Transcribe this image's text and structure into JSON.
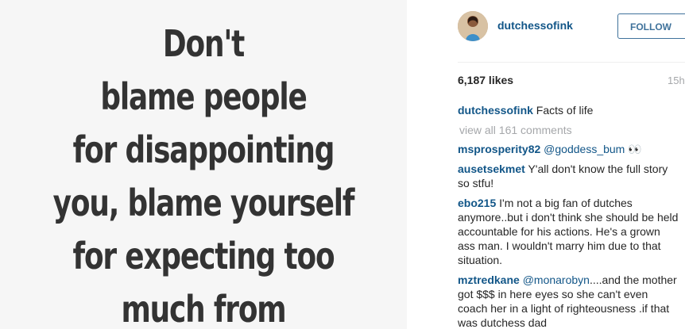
{
  "photo": {
    "quote_lines": [
      "Don't",
      "blame people",
      "for disappointing",
      "you, blame yourself",
      "for expecting too",
      "much from"
    ]
  },
  "header": {
    "username": "dutchessofink",
    "follow_label": "FOLLOW",
    "avatar_icon": "profile-avatar-icon"
  },
  "stats": {
    "likes": "6,187 likes",
    "time": "15h"
  },
  "caption": {
    "user": "dutchessofink",
    "text": "Facts of life"
  },
  "view_all": "view all 161 comments",
  "comments": [
    {
      "user": "msprosperity82",
      "mention": "@goddess_bum",
      "text": " 👀"
    },
    {
      "user": "ausetsekmet",
      "mention": "",
      "text": "Y'all don't know the full story so stfu!"
    },
    {
      "user": "ebo215",
      "mention": "",
      "text": "I'm not a big fan of dutches anymore..but i don't think she should be held accountable for his actions. He's a grown ass man. I wouldn't marry him due to that situation."
    },
    {
      "user": "mztredkane",
      "mention": "@monarobyn",
      "text": "....and the mother got $$$ in here eyes so she can't even coach her in a light of righteousness .if that was dutchess dad"
    }
  ],
  "colors": {
    "link": "#125688",
    "follow": "#3f729b",
    "muted": "#a5a7aa",
    "text": "#262626"
  }
}
